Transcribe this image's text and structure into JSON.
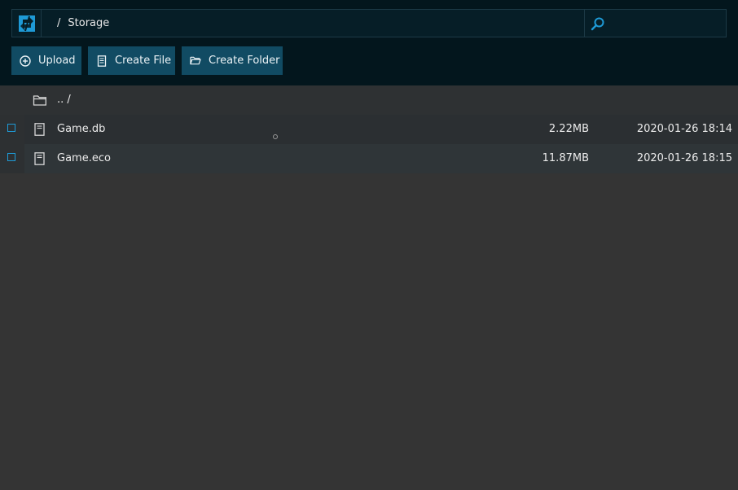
{
  "header": {
    "logo_icon": "refresh-logo-icon",
    "breadcrumb": {
      "separator": "/",
      "current": "Storage"
    },
    "search": {
      "icon": "search-icon",
      "value": "",
      "placeholder": ""
    }
  },
  "toolbar": {
    "upload_label": "Upload",
    "create_file_label": "Create File",
    "create_folder_label": "Create Folder"
  },
  "files": {
    "parent_label": ".. /",
    "rows": [
      {
        "name": "Game.db",
        "size": "2.22MB",
        "modified": "2020-01-26 18:14"
      },
      {
        "name": "Game.eco",
        "size": "11.87MB",
        "modified": "2020-01-26 18:15"
      }
    ]
  },
  "colors": {
    "header_bg": "#03161d",
    "button_bg": "#114b63",
    "accent": "#1e9ad6",
    "page_bg": "#343434"
  }
}
